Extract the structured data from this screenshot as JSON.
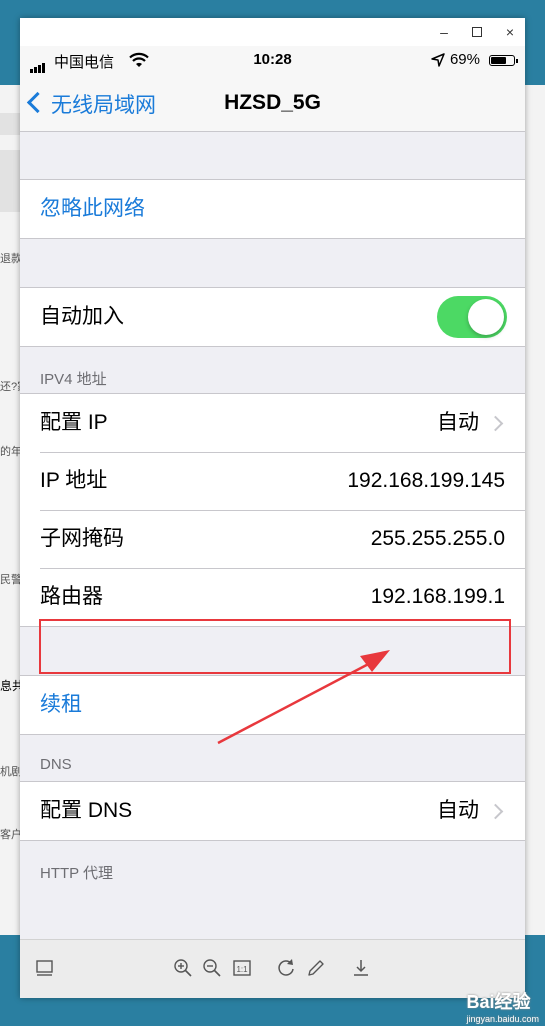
{
  "background_fragments": [
    "退款",
    "还?家",
    "的年终",
    "民警",
    "息共",
    "机剧",
    "客户"
  ],
  "window_controls": {
    "minimize": "–",
    "close": "×"
  },
  "statusbar": {
    "carrier": "中国电信",
    "time": "10:28",
    "battery": "69%",
    "battery_level": 0.69
  },
  "navbar": {
    "back_label": "无线局域网",
    "title": "HZSD_5G"
  },
  "forget": {
    "label": "忽略此网络"
  },
  "auto_join": {
    "label": "自动加入",
    "enabled": true
  },
  "ipv4": {
    "header": "IPV4 地址",
    "rows": [
      {
        "label": "配置 IP",
        "value": "自动"
      },
      {
        "label": "IP 地址",
        "value": "192.168.199.145"
      },
      {
        "label": "子网掩码",
        "value": "255.255.255.0"
      },
      {
        "label": "路由器",
        "value": "192.168.199.1"
      }
    ]
  },
  "renew": {
    "label": "续租"
  },
  "dns": {
    "header": "DNS",
    "row": {
      "label": "配置 DNS",
      "value": "自动"
    }
  },
  "http_proxy": {
    "header": "HTTP 代理"
  },
  "toolbar": {
    "icons": [
      "sidebar-icon",
      "zoom-in-icon",
      "zoom-out-icon",
      "actual-size-icon",
      "rotate-icon",
      "edit-icon",
      "download-icon"
    ],
    "actual_size_label": "1:1"
  },
  "watermark": {
    "text": "Bai经验",
    "sub": "jingyan.baidu.com"
  },
  "colors": {
    "accent": "#1a7bd9",
    "toggle_on": "#4cd964",
    "highlight": "#e8383d"
  }
}
